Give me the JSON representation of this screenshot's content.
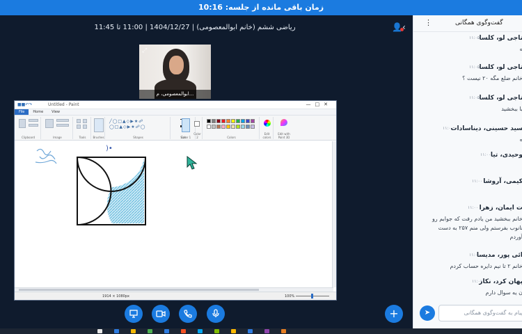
{
  "banner": {
    "text": "زمان باقی مانده از جلسه: 10:16"
  },
  "meeting": {
    "title": "ریاضی ششم (خانم ابوالمعصومی) | 1404/12/27 | 11:00 تا 11:45",
    "webcam_name": "ابوالمعصومی، م..."
  },
  "paint": {
    "window_title": "Untitled - Paint",
    "tabs": [
      "File",
      "Home",
      "View"
    ],
    "groups": [
      "Clipboard",
      "Image",
      "Tools",
      "Brushes",
      "Shapes",
      "Size",
      "Color 1",
      "Color 2",
      "Colors",
      "Edit colors",
      "Edit with Paint 3D"
    ],
    "status_dimensions": "1914 × 1080px",
    "status_zoom": "100%",
    "palette": [
      "#000000",
      "#7f7f7f",
      "#880015",
      "#ed1c24",
      "#ff7f27",
      "#fff200",
      "#22b14c",
      "#00a2e8",
      "#3f48cc",
      "#a349a4",
      "#ffffff",
      "#c3c3c3",
      "#b97a57",
      "#ffaec9",
      "#ffc90e",
      "#efe4b0",
      "#b5e61d",
      "#99d9ea",
      "#7092be",
      "#c8bfe7"
    ]
  },
  "controls": {
    "screen_icon": "screen-share-icon",
    "camera_icon": "camera-icon",
    "phone_icon": "phone-icon",
    "mic_icon": "microphone-icon",
    "plus_icon": "plus-icon"
  },
  "chat": {
    "header_title": "گفت‌وگوی همگانی",
    "messages": [
      {
        "name": "ناجی لو، کلسا",
        "time": "۱۱:۰۵",
        "text": "ه"
      },
      {
        "name": "ناجی لو، کلسا",
        "time": "۱۱:۰۵",
        "text": "خانم ضلع مگه ۲۰ نیست ؟"
      },
      {
        "name": "ناجی لو، کلسا",
        "time": "۱۱:۰۵",
        "text": "با ببخشید"
      },
      {
        "name": "سید حسینی، دیناسادات",
        "time": "۱۱:۰۰",
        "text": "ه"
      },
      {
        "name": "وحیدی، تیا",
        "time": "۱۱:۰۰",
        "text": ""
      },
      {
        "name": "کیمی، آروشا",
        "time": "۱۱:۰۰",
        "text": ""
      },
      {
        "name": "ت ایمان، زهرا",
        "time": "۱۱:۰۰",
        "text": "خانم ببخشید من یادم رفت که جوابم رو\nنانوب بفرستم ولی منم ۲۵۷ به دست\nآوردم"
      },
      {
        "name": "ائی پور، مدیسا",
        "time": "۱۱:۰۰",
        "text": "خانم ۲ تا نیم دایره حساب کردم"
      },
      {
        "name": "پهان کرد، نکار",
        "time": "۱۱:۰۱",
        "text": "ن یه سوال دارم"
      }
    ],
    "input_placeholder": "پیام به گفت‌وگوی همگانی"
  }
}
